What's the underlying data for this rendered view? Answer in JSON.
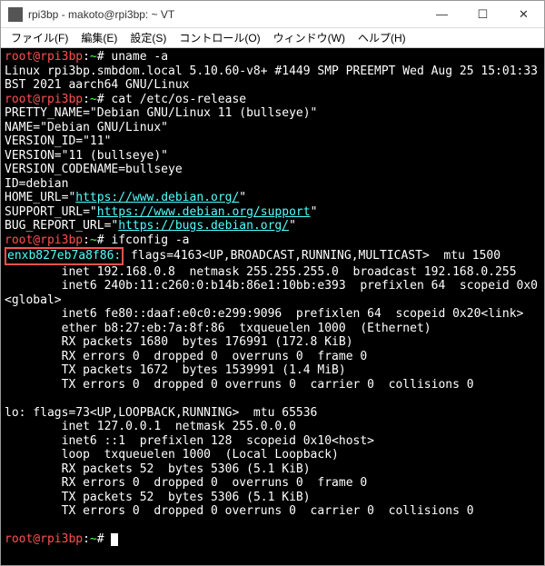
{
  "title": "rpi3bp - makoto@rpi3bp: ~ VT",
  "menu": {
    "file": "ファイル(F)",
    "edit": "編集(E)",
    "setup": "設定(S)",
    "control": "コントロール(O)",
    "window": "ウィンドウ(W)",
    "help": "ヘルプ(H)"
  },
  "prompt_user": "root@rpi3bp",
  "prompt_sep": ":",
  "prompt_path": "~",
  "prompt_hash": "# ",
  "cmd1": "uname -a",
  "out_uname": "Linux rpi3bp.smbdom.local 5.10.60-v8+ #1449 SMP PREEMPT Wed Aug 25 15:01:33 BST 2021 aarch64 GNU/Linux",
  "cmd2": "cat /etc/os-release",
  "os": {
    "pretty": "PRETTY_NAME=\"Debian GNU/Linux 11 (bullseye)\"",
    "name": "NAME=\"Debian GNU/Linux\"",
    "version_id": "VERSION_ID=\"11\"",
    "version": "VERSION=\"11 (bullseye)\"",
    "codename": "VERSION_CODENAME=bullseye",
    "id": "ID=debian",
    "home_pre": "HOME_URL=\"",
    "home_url": "https://www.debian.org/",
    "support_pre": "SUPPORT_URL=\"",
    "support_url": "https://www.debian.org/support",
    "bug_pre": "BUG_REPORT_URL=\"",
    "bug_url": "https://bugs.debian.org/",
    "quote_close": "\""
  },
  "cmd3": "ifconfig -a",
  "if1": {
    "name": "enxb827eb7a8f86:",
    "flags": " flags=4163<UP,BROADCAST,RUNNING,MULTICAST>  mtu 1500",
    "inet": "        inet 192.168.0.8  netmask 255.255.255.0  broadcast 192.168.0.255",
    "inet6a": "        inet6 240b:11:c260:0:b14b:86e1:10bb:e393  prefixlen 64  scopeid 0x0<global>",
    "inet6b": "        inet6 fe80::daaf:e0c0:e299:9096  prefixlen 64  scopeid 0x20<link>",
    "ether": "        ether b8:27:eb:7a:8f:86  txqueuelen 1000  (Ethernet)",
    "rxp": "        RX packets 1680  bytes 176991 (172.8 KiB)",
    "rxe": "        RX errors 0  dropped 0  overruns 0  frame 0",
    "txp": "        TX packets 1672  bytes 1539991 (1.4 MiB)",
    "txe": "        TX errors 0  dropped 0 overruns 0  carrier 0  collisions 0"
  },
  "if2": {
    "header": "lo: flags=73<UP,LOOPBACK,RUNNING>  mtu 65536",
    "inet": "        inet 127.0.0.1  netmask 255.0.0.0",
    "inet6": "        inet6 ::1  prefixlen 128  scopeid 0x10<host>",
    "loop": "        loop  txqueuelen 1000  (Local Loopback)",
    "rxp": "        RX packets 52  bytes 5306 (5.1 KiB)",
    "rxe": "        RX errors 0  dropped 0  overruns 0  frame 0",
    "txp": "        TX packets 52  bytes 5306 (5.1 KiB)",
    "txe": "        TX errors 0  dropped 0 overruns 0  carrier 0  collisions 0"
  }
}
